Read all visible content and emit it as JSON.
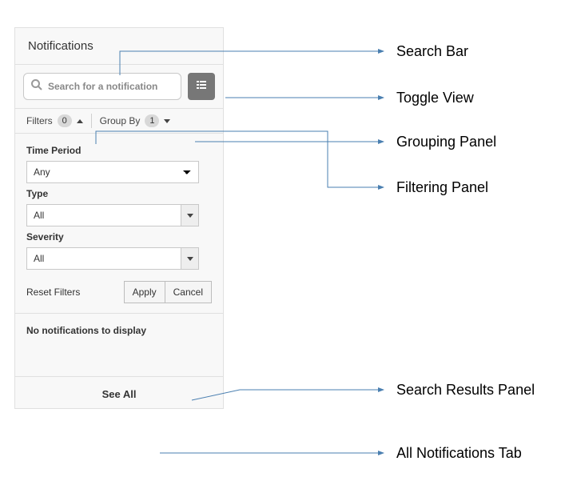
{
  "header": {
    "title": "Notifications"
  },
  "search": {
    "placeholder": "Search for a notification"
  },
  "tabs": {
    "filters_label": "Filters",
    "filters_count": "0",
    "groupby_label": "Group By",
    "groupby_count": "1"
  },
  "filters": {
    "time_label": "Time Period",
    "time_value": "Any",
    "type_label": "Type",
    "type_value": "All",
    "severity_label": "Severity",
    "severity_value": "All",
    "reset_label": "Reset Filters",
    "apply_label": "Apply",
    "cancel_label": "Cancel"
  },
  "results": {
    "empty_message": "No notifications to display"
  },
  "footer": {
    "see_all_label": "See All"
  },
  "annotations": {
    "search_bar": "Search Bar",
    "toggle_view": "Toggle View",
    "grouping_panel": "Grouping Panel",
    "filtering_panel": "Filtering Panel",
    "search_results_panel": "Search Results Panel",
    "all_notifications_tab": "All Notifications Tab"
  }
}
